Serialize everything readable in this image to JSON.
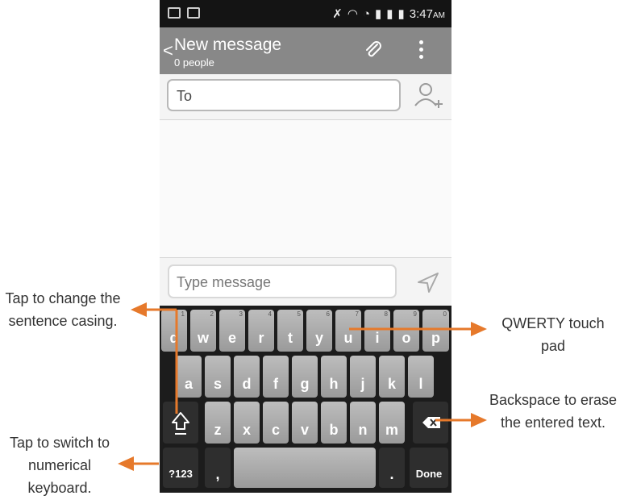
{
  "status_bar": {
    "time": "3:47",
    "time_suffix": "AM"
  },
  "action_bar": {
    "title": "New message",
    "subtitle": "0 people",
    "back": "<"
  },
  "recipient": {
    "placeholder": "To"
  },
  "compose": {
    "placeholder": "Type message"
  },
  "keyboard": {
    "row1": [
      {
        "key": "q",
        "hint": "1"
      },
      {
        "key": "w",
        "hint": "2"
      },
      {
        "key": "e",
        "hint": "3"
      },
      {
        "key": "r",
        "hint": "4"
      },
      {
        "key": "t",
        "hint": "5"
      },
      {
        "key": "y",
        "hint": "6"
      },
      {
        "key": "u",
        "hint": "7"
      },
      {
        "key": "i",
        "hint": "8"
      },
      {
        "key": "o",
        "hint": "9"
      },
      {
        "key": "p",
        "hint": "0"
      }
    ],
    "row2": [
      "a",
      "s",
      "d",
      "f",
      "g",
      "h",
      "j",
      "k",
      "l"
    ],
    "row3": [
      "z",
      "x",
      "c",
      "v",
      "b",
      "n",
      "m"
    ],
    "num_key": "?123",
    "comma_key": ",",
    "period_key": ".",
    "done_key": "Done"
  },
  "annotations": {
    "shift": "Tap to change the sentence casing.",
    "numeric": "Tap to switch to numerical keyboard.",
    "qwerty": "QWERTY touch pad",
    "backspace": "Backspace to erase the entered text."
  },
  "colors": {
    "arrow": "#e6792b",
    "action_bar": "#888888"
  }
}
